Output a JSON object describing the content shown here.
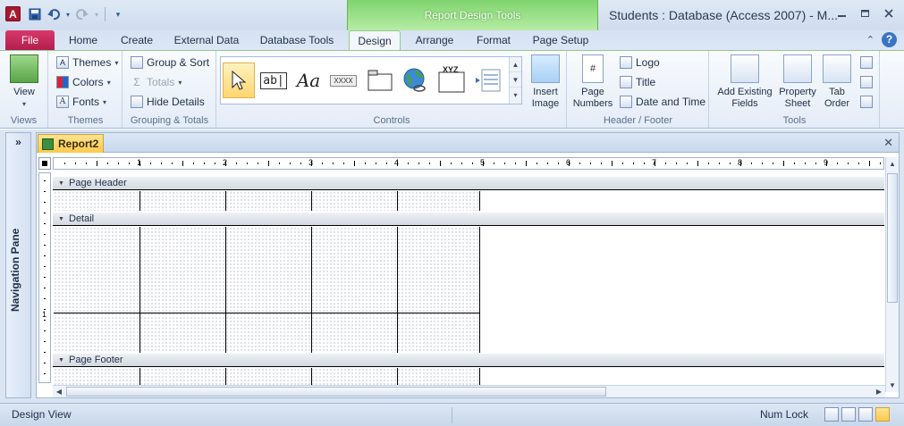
{
  "app": {
    "icon_letter": "A",
    "window_title": "Students : Database (Access 2007) - M...",
    "context_tab_header": "Report Design Tools",
    "window_controls": [
      "minimize-icon",
      "restore-icon",
      "close-icon"
    ]
  },
  "quick_access": {
    "items": [
      "save-icon",
      "undo-icon",
      "redo-icon",
      "customize-icon"
    ]
  },
  "tabs": {
    "items": [
      {
        "label": "File"
      },
      {
        "label": "Home"
      },
      {
        "label": "Create"
      },
      {
        "label": "External Data"
      },
      {
        "label": "Database Tools"
      },
      {
        "label": "Design"
      },
      {
        "label": "Arrange"
      },
      {
        "label": "Format"
      },
      {
        "label": "Page Setup"
      }
    ],
    "active": "Design"
  },
  "ribbon": {
    "views": {
      "label": "Views",
      "view_button": "View"
    },
    "themes": {
      "label": "Themes",
      "themes": "Themes",
      "colors": "Colors",
      "fonts": "Fonts"
    },
    "grouping": {
      "label": "Grouping & Totals",
      "group_sort": "Group & Sort",
      "totals": "Totals",
      "hide_details": "Hide Details"
    },
    "controls": {
      "label": "Controls",
      "insert_image": "Insert\nImage",
      "textbox_glyph": "ab|",
      "label_glyph": "Aa",
      "button_glyph": "XXXX",
      "chart_glyph": "XYZ"
    },
    "header_footer": {
      "label": "Header / Footer",
      "page_numbers": "Page\nNumbers",
      "logo": "Logo",
      "title": "Title",
      "date_time": "Date and Time"
    },
    "tools": {
      "label": "Tools",
      "add_existing_fields": "Add Existing\nFields",
      "property_sheet": "Property\nSheet",
      "tab_order": "Tab\nOrder"
    }
  },
  "navigation_pane": {
    "label": "Navigation Pane",
    "expand": "»"
  },
  "document": {
    "tab_label": "Report2",
    "close": "✕",
    "ruler_numbers": [
      "1",
      "2",
      "3",
      "4",
      "5",
      "6",
      "7",
      "8",
      "9"
    ],
    "vruler_numbers": [
      "1"
    ],
    "sections": {
      "page_header": "Page Header",
      "detail": "Detail",
      "page_footer": "Page Footer"
    }
  },
  "statusbar": {
    "left": "Design View",
    "right": "Num Lock",
    "views": [
      "report-view-icon",
      "print-preview-icon",
      "layout-view-icon",
      "design-view-icon"
    ]
  },
  "colors": {
    "file_tab": "#c02b57",
    "context_header": "#7fd46e",
    "selected_tool": "#ffd66e"
  }
}
